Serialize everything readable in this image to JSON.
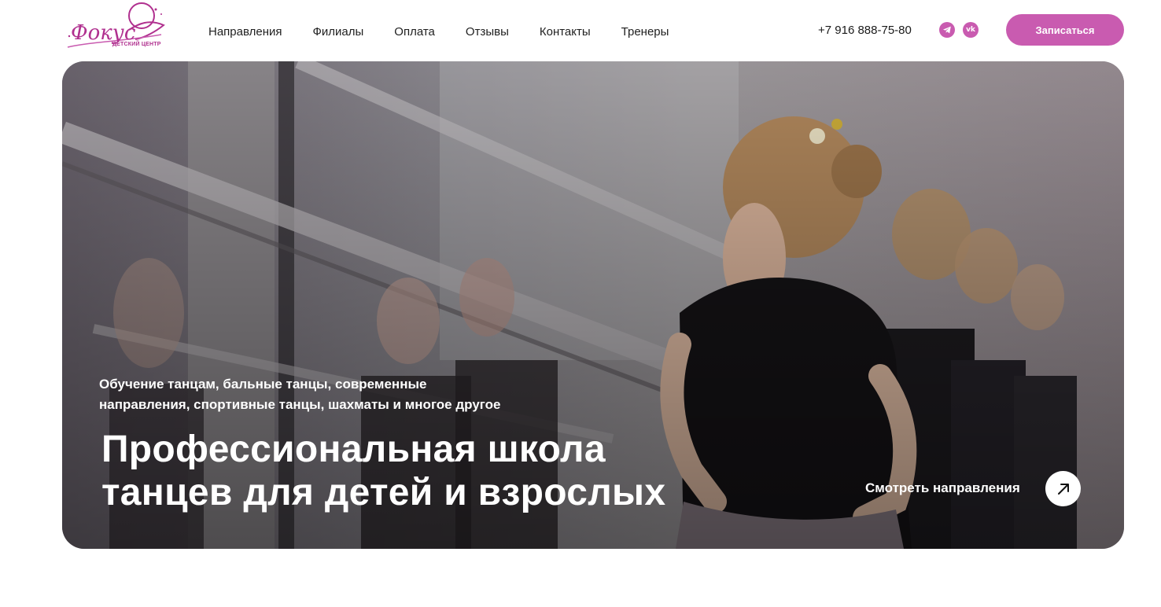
{
  "brand": {
    "logo_script": "Фокус",
    "logo_caption": "ДЕТСКИЙ ЦЕНТР",
    "color": "#b0308f"
  },
  "nav": {
    "items": [
      {
        "label": "Направления"
      },
      {
        "label": "Филиалы"
      },
      {
        "label": "Оплата"
      },
      {
        "label": "Отзывы"
      },
      {
        "label": "Контакты"
      },
      {
        "label": "Тренеры"
      }
    ]
  },
  "contact": {
    "phone": "+7 916 888-75-80",
    "social": [
      {
        "icon": "telegram-icon"
      },
      {
        "icon": "vk-icon",
        "text": "vk"
      }
    ]
  },
  "header": {
    "cta_label": "Записаться",
    "accent": "#c95bb0"
  },
  "hero": {
    "subtitle": "Обучение танцам, бальные танцы, современные направления, спортивные танцы, шахматы и многое другое",
    "title": "Профессиональная школа танцев для детей и взрослых",
    "link_label": "Смотреть направления",
    "link_icon": "arrow-up-right-icon",
    "image": "children-ballet-class-photo"
  }
}
